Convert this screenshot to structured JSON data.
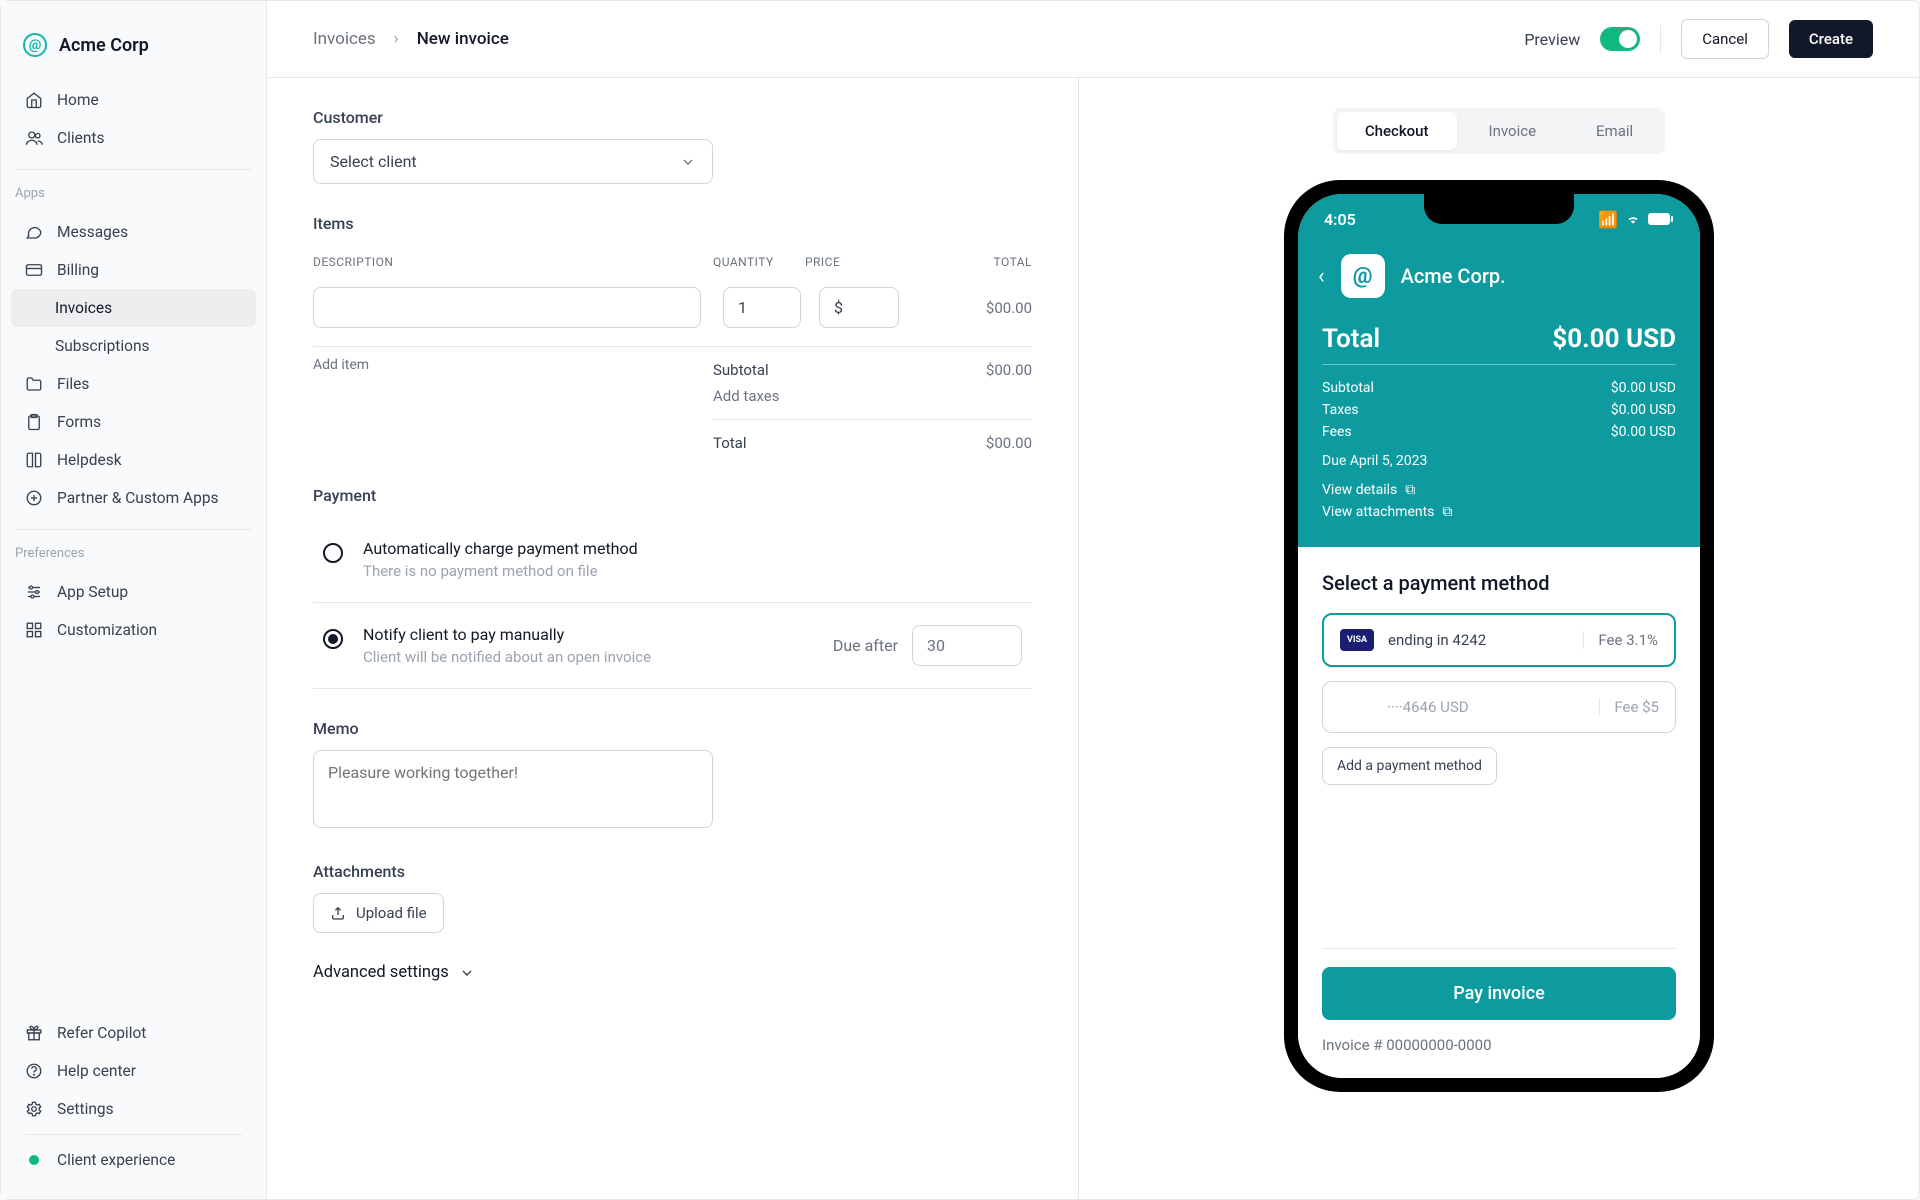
{
  "brand": {
    "name": "Acme Corp"
  },
  "nav": {
    "main": [
      {
        "label": "Home"
      },
      {
        "label": "Clients"
      }
    ],
    "apps_label": "Apps",
    "apps": [
      {
        "label": "Messages"
      },
      {
        "label": "Billing"
      },
      {
        "label": "Invoices"
      },
      {
        "label": "Subscriptions"
      },
      {
        "label": "Files"
      },
      {
        "label": "Forms"
      },
      {
        "label": "Helpdesk"
      },
      {
        "label": "Partner & Custom Apps"
      }
    ],
    "prefs_label": "Preferences",
    "prefs": [
      {
        "label": "App Setup"
      },
      {
        "label": "Customization"
      }
    ],
    "footer": [
      {
        "label": "Refer Copilot"
      },
      {
        "label": "Help center"
      },
      {
        "label": "Settings"
      },
      {
        "label": "Client experience"
      }
    ]
  },
  "breadcrumb": {
    "parent": "Invoices",
    "current": "New invoice"
  },
  "header": {
    "preview": "Preview",
    "cancel": "Cancel",
    "create": "Create"
  },
  "form": {
    "customer_label": "Customer",
    "select_client": "Select client",
    "items_label": "Items",
    "cols": {
      "desc": "DESCRIPTION",
      "qty": "QUANTITY",
      "price": "PRICE",
      "total": "TOTAL"
    },
    "row": {
      "qty": "1",
      "price": "$",
      "total": "$00.00"
    },
    "add_item": "Add item",
    "subtotal_label": "Subtotal",
    "subtotal": "$00.00",
    "add_taxes": "Add taxes",
    "total_label": "Total",
    "total": "$00.00",
    "payment_label": "Payment",
    "opt1_title": "Automatically charge payment method",
    "opt1_sub": "There is no payment method on file",
    "opt2_title": "Notify client to pay manually",
    "opt2_sub": "Client will be notified about an open invoice",
    "due_after_label": "Due after",
    "due_after_value": "30",
    "memo_label": "Memo",
    "memo_placeholder": "Pleasure working together!",
    "attachments_label": "Attachments",
    "upload": "Upload file",
    "advanced": "Advanced settings"
  },
  "segmented": {
    "checkout": "Checkout",
    "invoice": "Invoice",
    "email": "Email"
  },
  "phone": {
    "time": "4:05",
    "brand": "Acme Corp.",
    "total_label": "Total",
    "total_value": "$0.00 USD",
    "lines": {
      "subtotal_l": "Subtotal",
      "subtotal_v": "$0.00 USD",
      "taxes_l": "Taxes",
      "taxes_v": "$0.00 USD",
      "fees_l": "Fees",
      "fees_v": "$0.00 USD"
    },
    "due": "Due April 5, 2023",
    "view_details": "View details",
    "view_attachments": "View attachments",
    "select_method": "Select a payment method",
    "method1_text": "ending in 4242",
    "method1_fee": "Fee 3.1%",
    "method2_text": "····4646 USD",
    "method2_fee": "Fee $5",
    "add_method": "Add a payment method",
    "pay": "Pay invoice",
    "invoice_num": "Invoice # 00000000-0000"
  }
}
